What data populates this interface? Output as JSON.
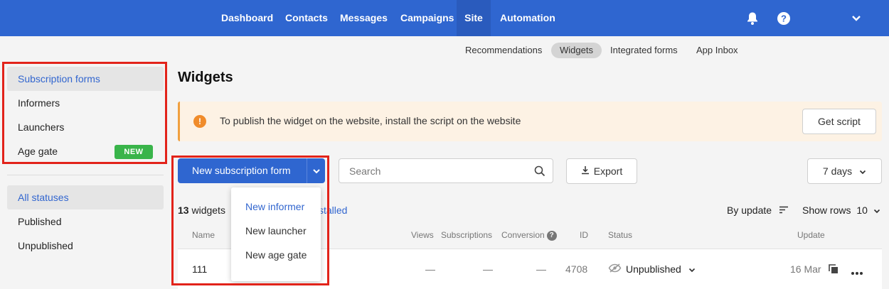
{
  "topnav": {
    "items": [
      "Dashboard",
      "Contacts",
      "Messages",
      "Campaigns",
      "Site",
      "Automation"
    ],
    "active": "Site",
    "icons": [
      "bell-icon",
      "help-icon",
      "chevron-down-icon"
    ]
  },
  "subnav": {
    "items": [
      "Recommendations",
      "Widgets",
      "Integrated forms",
      "App Inbox"
    ],
    "active": "Widgets"
  },
  "sidebar": {
    "types": [
      "Subscription forms",
      "Informers",
      "Launchers",
      "Age gate"
    ],
    "active_type": "Subscription forms",
    "new_badge": "NEW",
    "statuses": [
      "All statuses",
      "Published",
      "Unpublished"
    ],
    "active_status": "All statuses"
  },
  "page": {
    "title": "Widgets"
  },
  "alert": {
    "icon": "!",
    "text": "To publish the widget on the website, install the script on the website",
    "button": "Get script"
  },
  "toolbar": {
    "new_button": "New subscription form",
    "search_placeholder": "Search",
    "export_label": "Export",
    "period_label": "7 days"
  },
  "dropdown": {
    "items": [
      "New informer",
      "New launcher",
      "New age gate"
    ],
    "active": "New informer"
  },
  "summary": {
    "count": "13",
    "count_label": "widgets",
    "installed_link_partial": "stalled",
    "sort_label": "By update",
    "rows_label": "Show rows",
    "rows_value": "10"
  },
  "table": {
    "headers": {
      "name": "Name",
      "views": "Views",
      "subscriptions": "Subscriptions",
      "conversion": "Conversion",
      "id": "ID",
      "status": "Status",
      "update": "Update"
    },
    "rows": [
      {
        "name": "111",
        "views": "—",
        "subscriptions": "—",
        "conversion": "—",
        "id": "4708",
        "status": "Unpublished",
        "update": "16 Mar"
      }
    ]
  },
  "colors": {
    "brand": "#2f66d0",
    "accent_link": "#3266cf",
    "highlight_box": "#e2231a",
    "badge": "#39b44a",
    "alert_bg": "#fdf2e4",
    "alert_icon": "#f08c2b"
  }
}
